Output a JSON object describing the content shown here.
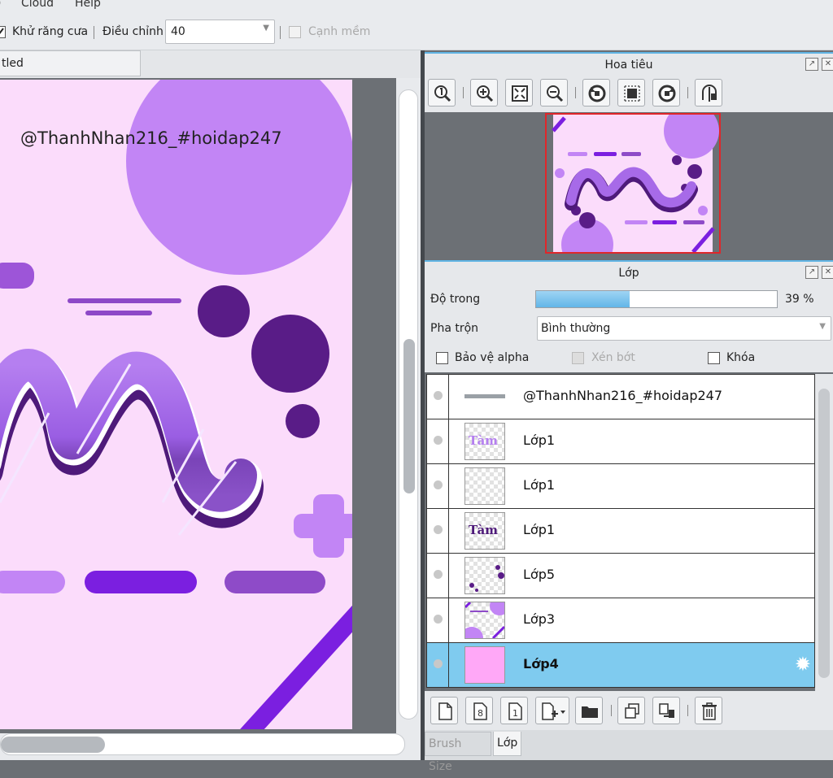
{
  "menu": {
    "items": [
      "Cloud",
      "Help"
    ]
  },
  "options": {
    "antialias_label": "Khử răng cưa",
    "adjust_label": "Điều chỉnh",
    "adjust_value": "40",
    "soft_edge_label": "Cạnh mềm"
  },
  "document": {
    "tab_label": "tled"
  },
  "artwork": {
    "watermark": "@ThanhNhan216_#hoidap247",
    "colors": {
      "background": "#fbdcfb",
      "circle": "#c285f5",
      "dark": "#591c87",
      "mid": "#9d55d8",
      "bright": "#7b1fe0"
    }
  },
  "navigator": {
    "title": "Hoa tiêu",
    "tools": [
      "zoom-actual-icon",
      "zoom-in-icon",
      "fit-icon",
      "zoom-out-icon",
      "rotate-left-icon",
      "reset-rotation-icon",
      "rotate-right-icon",
      "flip-icon"
    ]
  },
  "layers_panel": {
    "title": "Lớp",
    "opacity_label": "Độ trong",
    "opacity_value": "39 %",
    "opacity_fraction": 0.39,
    "blend_label": "Pha trộn",
    "blend_value": "Bình thường",
    "protect_alpha_label": "Bảo vệ alpha",
    "clipping_label": "Xén bớt",
    "lock_label": "Khóa",
    "layers": [
      {
        "name": "@ThanhNhan216_#hoidap247",
        "thumb": "text",
        "selected": false
      },
      {
        "name": "Lớp1",
        "thumb": "word-light",
        "selected": false
      },
      {
        "name": "Lớp1",
        "thumb": "empty",
        "selected": false
      },
      {
        "name": "Lớp1",
        "thumb": "word-dark",
        "selected": false
      },
      {
        "name": "Lớp5",
        "thumb": "dots",
        "selected": false
      },
      {
        "name": "Lớp3",
        "thumb": "shapes",
        "selected": false
      },
      {
        "name": "Lớp4",
        "thumb": "fill",
        "selected": true
      }
    ],
    "thumb_word": "Tàm",
    "thumb_duplicate_number": "8",
    "thumb_merge_number": "1"
  },
  "bottom_tabs": {
    "brush_size": "Brush Size",
    "layer": "Lớp"
  }
}
